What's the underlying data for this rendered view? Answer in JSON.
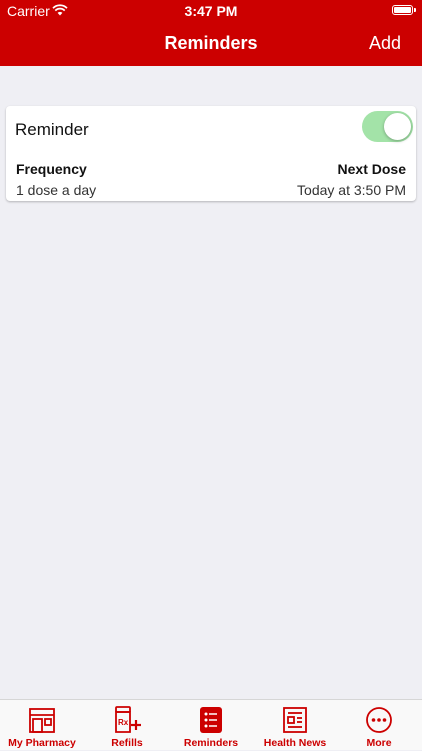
{
  "status": {
    "carrier": "Carrier",
    "time": "3:47 PM"
  },
  "navbar": {
    "title": "Reminders",
    "add_label": "Add"
  },
  "reminder": {
    "title": "Reminder",
    "enabled": true,
    "frequency_label": "Frequency",
    "frequency_value": "1 dose a day",
    "next_label": "Next Dose",
    "next_value": "Today at 3:50 PM"
  },
  "tabs": [
    {
      "label": "My Pharmacy",
      "icon": "storefront-icon"
    },
    {
      "label": "Refills",
      "icon": "rx-refill-icon"
    },
    {
      "label": "Reminders",
      "icon": "checklist-icon",
      "selected": true
    },
    {
      "label": "Health News",
      "icon": "newspaper-icon"
    },
    {
      "label": "More",
      "icon": "more-icon"
    }
  ],
  "colors": {
    "accent": "#cc0000",
    "toggle_on": "#a3e3a8",
    "background": "#efeff4"
  }
}
